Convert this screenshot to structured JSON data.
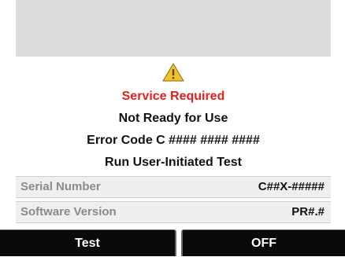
{
  "alert": {
    "icon": "warning-triangle-icon",
    "icon_color": "#f2c12e",
    "title": "Service Required",
    "title_color": "#e5201b",
    "line2": "Not Ready for Use",
    "line3": "Error Code C #### #### ####",
    "line4": "Run User-Initiated Test"
  },
  "info": [
    {
      "label": "Serial Number",
      "value": "C##X-#####"
    },
    {
      "label": "Software Version",
      "value": "PR#.#"
    }
  ],
  "softkeys": {
    "left": "Test",
    "right": "OFF"
  }
}
